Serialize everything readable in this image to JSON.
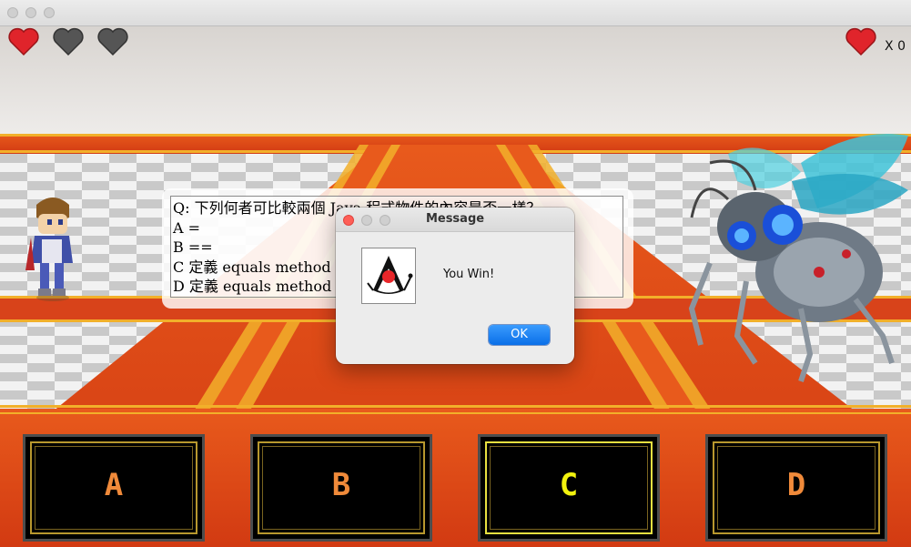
{
  "window": {
    "traffic_lights": [
      "close",
      "minimize",
      "zoom"
    ]
  },
  "hud": {
    "lives": [
      {
        "state": "full",
        "color": "#e0242b"
      },
      {
        "state": "empty",
        "color": "#555555"
      },
      {
        "state": "empty",
        "color": "#555555"
      }
    ],
    "score_icon": "heart-icon",
    "score_text": "X 0"
  },
  "question": {
    "lines": [
      "Q: 下列何者可比較兩個 Java 程式物件的內容是否一樣？",
      "A =",
      "B ==",
      "C 定義 equals method 比",
      "D 定義 equals method 比"
    ]
  },
  "answers": [
    {
      "label": "A",
      "selected": false
    },
    {
      "label": "B",
      "selected": false
    },
    {
      "label": "C",
      "selected": true
    },
    {
      "label": "D",
      "selected": false
    }
  ],
  "dialog": {
    "title": "Message",
    "message": "You Win!",
    "ok_label": "OK",
    "icon": "java-duke-icon"
  },
  "colors": {
    "carpet": "#e0421a",
    "carpet_border": "#f2b02a",
    "selected_answer": "#f2f20e",
    "answer_label": "#f08a3a"
  }
}
